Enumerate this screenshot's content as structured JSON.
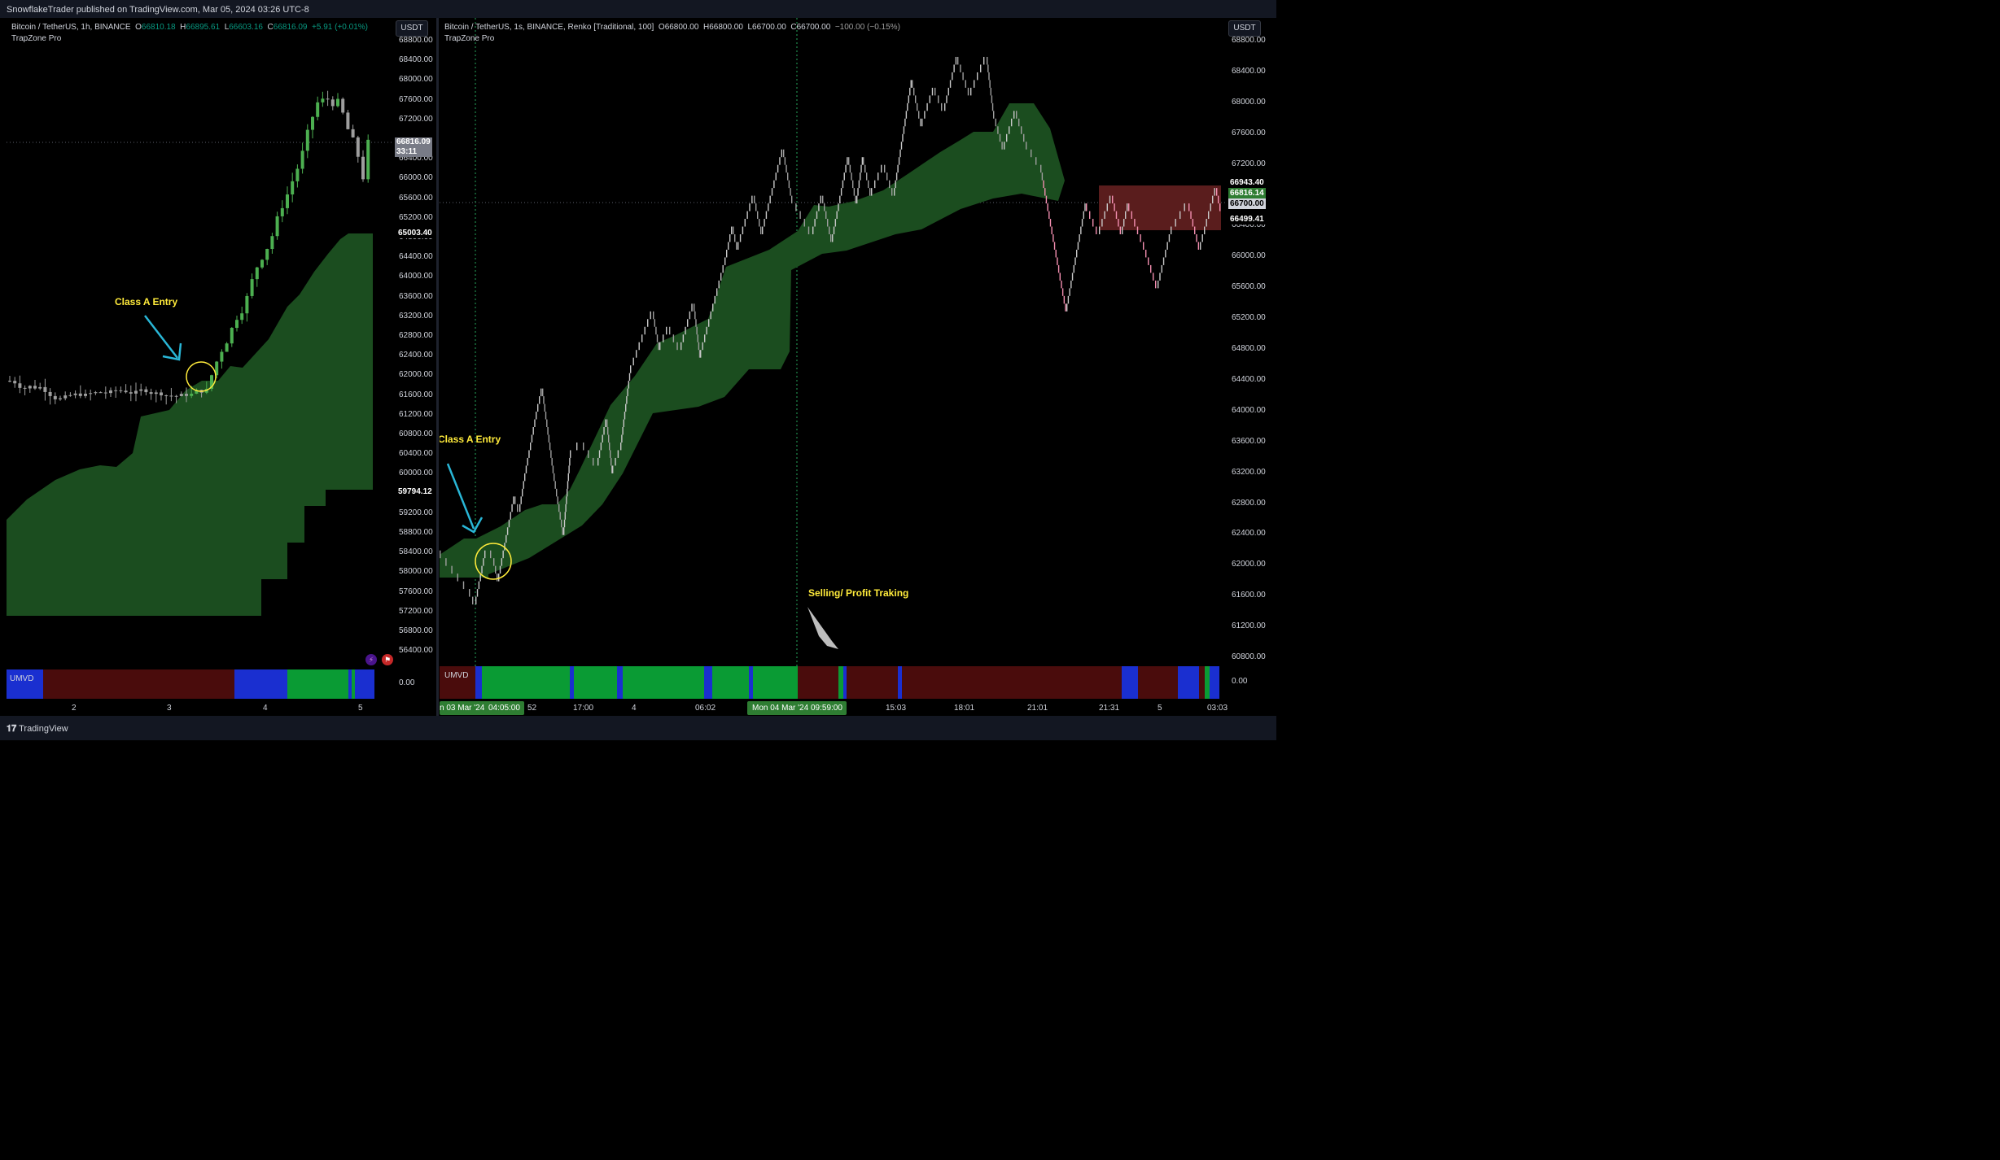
{
  "header": {
    "published": "SnowflakeTrader published on TradingView.com, Mar 05, 2024 03:26 UTC-8"
  },
  "footer": {
    "brand": "TradingView",
    "logo_icon": "tradingview-logo-icon"
  },
  "left_chart": {
    "legend": {
      "symbol": "Bitcoin / TetherUS, 1h, BINANCE",
      "open_label": "O",
      "open": "66810.18",
      "high_label": "H",
      "high": "66895.61",
      "low_label": "L",
      "low": "66603.16",
      "close_label": "C",
      "close": "66816.09",
      "change": "+5.91 (+0.01%)"
    },
    "indicator": "TrapZone Pro",
    "currency": "USDT",
    "price_ticks": [
      "68800.00",
      "68400.00",
      "68000.00",
      "67600.00",
      "67200.00",
      "66400.00",
      "66000.00",
      "65600.00",
      "65200.00",
      "64800.00",
      "64400.00",
      "64000.00",
      "63600.00",
      "63200.00",
      "62800.00",
      "62400.00",
      "62000.00",
      "61600.00",
      "61200.00",
      "60800.00",
      "60400.00",
      "60000.00",
      "59600.00",
      "59200.00",
      "58800.00",
      "58400.00",
      "58000.00",
      "57600.00",
      "57200.00",
      "56800.00",
      "56400.00"
    ],
    "last_price": "66816.09",
    "countdown": "33:11",
    "level_high": "65003.40",
    "level_low": "59794.12",
    "annotation": "Class A Entry",
    "sub_indicator": "UMVD",
    "sub_value": "0.00",
    "time_ticks": [
      "2",
      "3",
      "4",
      "5"
    ]
  },
  "right_chart": {
    "legend": {
      "symbol": "Bitcoin / TetherUS, 1s, BINANCE, Renko [Traditional, 100]",
      "open_label": "O",
      "open": "66800.00",
      "high_label": "H",
      "high": "66800.00",
      "low_label": "L",
      "low": "66700.00",
      "close_label": "C",
      "close": "66700.00",
      "change": "−100.00 (−0.15%)"
    },
    "indicator": "TrapZone Pro",
    "currency": "USDT",
    "price_ticks": [
      "68800.00",
      "68400.00",
      "68000.00",
      "67600.00",
      "67200.00",
      "66400.00",
      "66000.00",
      "65600.00",
      "65200.00",
      "64800.00",
      "64400.00",
      "64000.00",
      "63600.00",
      "63200.00",
      "62800.00",
      "62400.00",
      "62000.00",
      "61600.00",
      "61200.00",
      "60800.00"
    ],
    "price_label_1": "66943.40",
    "price_label_2": "66816.14",
    "price_label_3": "66700.00",
    "price_label_4": "66499.41",
    "annotation_entry": "Class A Entry",
    "annotation_sell": "Selling/ Profit Traking",
    "sub_indicator": "UMVD",
    "sub_value": "0.00",
    "time_ticks": [
      "n 03 Mar '24",
      "04:05:00",
      "52",
      "17:00",
      "4",
      "06:02",
      "Mon 04 Mar '24",
      "09:59:00",
      "15:03",
      "18:01",
      "21:01",
      "21:31",
      "5",
      "03:03"
    ]
  },
  "colors": {
    "bull": "#4caf50",
    "bear": "#f48fb1",
    "neutral": "#9e9e9e",
    "zone_green": "#1b4d1f",
    "zone_red": "#5a1d1d",
    "umvd_red": "#4a0c0c",
    "umvd_blue": "#1a2fd0",
    "umvd_green": "#0a9b34",
    "annotation": "#ffeb3b",
    "arrow": "#29b6d6",
    "last_price_bg": "#787b86",
    "level_bg": "#2e7d32"
  }
}
